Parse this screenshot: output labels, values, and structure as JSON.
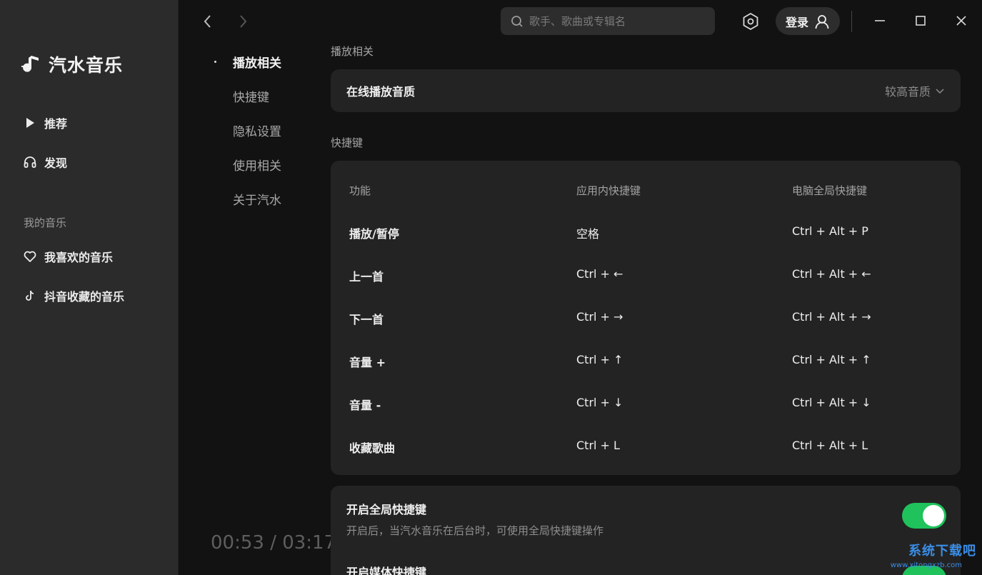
{
  "app": {
    "name": "汽水音乐"
  },
  "sidebar": {
    "items": [
      {
        "label": "推荐",
        "icon": "play-icon"
      },
      {
        "label": "发现",
        "icon": "headphones-icon"
      }
    ],
    "section_label": "我的音乐",
    "my_music": [
      {
        "label": "我喜欢的音乐",
        "icon": "heart-icon"
      },
      {
        "label": "抖音收藏的音乐",
        "icon": "douyin-icon"
      }
    ]
  },
  "header": {
    "search_placeholder": "歌手、歌曲或专辑名",
    "login_label": "登录"
  },
  "subnav": {
    "items": [
      "播放相关",
      "快捷键",
      "隐私设置",
      "使用相关",
      "关于汽水"
    ],
    "active_index": 0
  },
  "player": {
    "time": "00:53 / 03:17"
  },
  "settings": {
    "playback_heading": "播放相关",
    "quality_label": "在线播放音质",
    "quality_value": "较高音质",
    "shortcut_heading": "快捷键",
    "shortcut_columns": [
      "功能",
      "应用内快捷键",
      "电脑全局快捷键"
    ],
    "shortcuts": [
      [
        "播放/暂停",
        "空格",
        "Ctrl + Alt + P"
      ],
      [
        "上一首",
        "Ctrl + ←",
        "Ctrl + Alt + ←"
      ],
      [
        "下一首",
        "Ctrl + →",
        "Ctrl + Alt + →"
      ],
      [
        "音量 +",
        "Ctrl + ↑",
        "Ctrl + Alt + ↑"
      ],
      [
        "音量 -",
        "Ctrl + ↓",
        "Ctrl + Alt + ↓"
      ],
      [
        "收藏歌曲",
        "Ctrl + L",
        "Ctrl + Alt + L"
      ]
    ],
    "global_toggle_title": "开启全局快捷键",
    "global_toggle_desc": "开启后，当汽水音乐在后台时，可使用全局快捷键操作",
    "global_toggle_on": true,
    "media_toggle_title": "开启媒体快捷键"
  },
  "watermark": {
    "text": "系统下载吧",
    "sub": "www.xitongxzb.com"
  },
  "colors": {
    "accent_green": "#1fc25b",
    "sidebar_bg": "#2b2b2b",
    "main_bg": "#121212",
    "card_bg": "#232323"
  }
}
